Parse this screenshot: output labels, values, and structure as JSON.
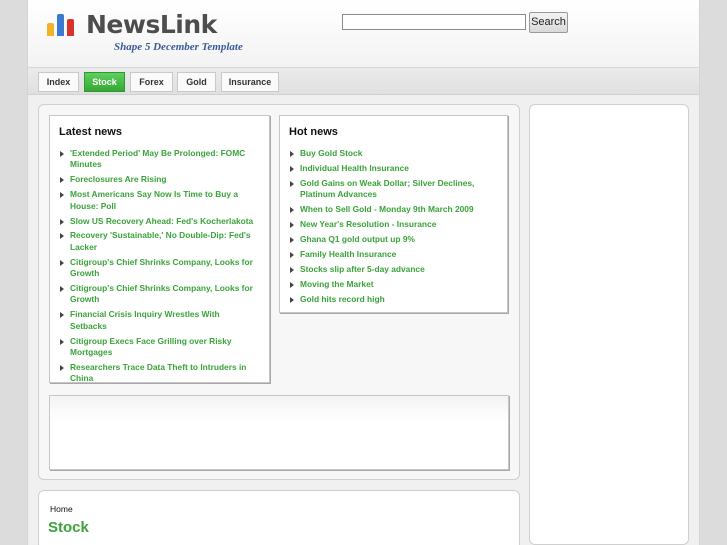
{
  "header": {
    "logo_text": "NewsLink",
    "tagline": "Shape 5 December Template",
    "search": {
      "value": "",
      "placeholder": ""
    },
    "search_button": "Search"
  },
  "nav": {
    "items": [
      {
        "label": "Index",
        "active": false
      },
      {
        "label": "Stock",
        "active": true
      },
      {
        "label": "Forex",
        "active": false
      },
      {
        "label": "Gold",
        "active": false
      },
      {
        "label": "Insurance",
        "active": false
      }
    ]
  },
  "latest_news": {
    "title": "Latest news",
    "items": [
      "'Extended Period' May Be Prolonged: FOMC Minutes",
      "Foreclosures Are Rising",
      "Most Americans Say Now Is Time to Buy a House: Poll",
      "Slow US Recovery Ahead: Fed's Kocherlakota",
      "Recovery 'Sustainable,' No Double-Dip: Fed's Lacker",
      "Citigroup's Chief Shrinks Company, Looks for Growth",
      "Citigroup's Chief Shrinks Company, Looks for Growth",
      "Financial Crisis Inquiry Wrestles With Setbacks",
      "Citigroup Execs Face Grilling over Risky Mortgages",
      "Researchers Trace Data Theft to Intruders in China"
    ]
  },
  "hot_news": {
    "title": "Hot news",
    "items": [
      "Buy Gold Stock",
      "Individual Health Insurance",
      "Gold Gains on Weak Dollar; Silver Declines, Platinum Advances",
      "When to Sell Gold - Monday 9th March 2009",
      "New Year's Resolution - Insurance",
      "Ghana Q1 gold output up 9%",
      "Family Health Insurance",
      "Stocks slip after 5-day advance",
      "Moving the Market",
      "Gold hits record high"
    ]
  },
  "content": {
    "breadcrumb": "Home",
    "page_title": "Stock"
  },
  "colors": {
    "accent_green": "#3aa33a",
    "nav_active": "#34a834",
    "tagline_blue": "#3a5b9a"
  }
}
